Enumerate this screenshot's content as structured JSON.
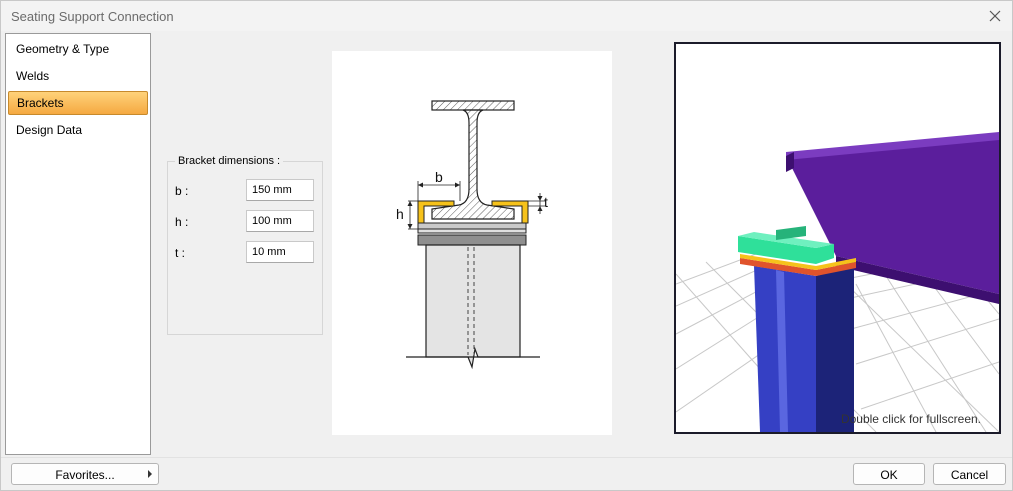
{
  "window": {
    "title": "Seating Support Connection",
    "close_icon": "close-icon"
  },
  "nav": {
    "items": [
      {
        "label": "Geometry & Type",
        "selected": false
      },
      {
        "label": "Welds",
        "selected": false
      },
      {
        "label": "Brackets",
        "selected": true
      },
      {
        "label": "Design Data",
        "selected": false
      }
    ],
    "selected_color": "#f5a941"
  },
  "bracket_group": {
    "title": "Bracket dimensions :",
    "fields": [
      {
        "label": "b :",
        "value": "150 mm"
      },
      {
        "label": "h :",
        "value": "100 mm"
      },
      {
        "label": "t :",
        "value": "10 mm"
      }
    ]
  },
  "diagram": {
    "label_b": "b",
    "label_h": "h",
    "label_t": "t",
    "bracket_color": "#f6c21b"
  },
  "view3d": {
    "hint": "Double click for fullscreen.",
    "beam_color": "#5b1e9c",
    "column_color": "#3540c4",
    "plate_color": "#2fe09a",
    "bracket_color": "#f6c21b"
  },
  "footer": {
    "favorites_label": "Favorites...",
    "ok_label": "OK",
    "cancel_label": "Cancel"
  }
}
